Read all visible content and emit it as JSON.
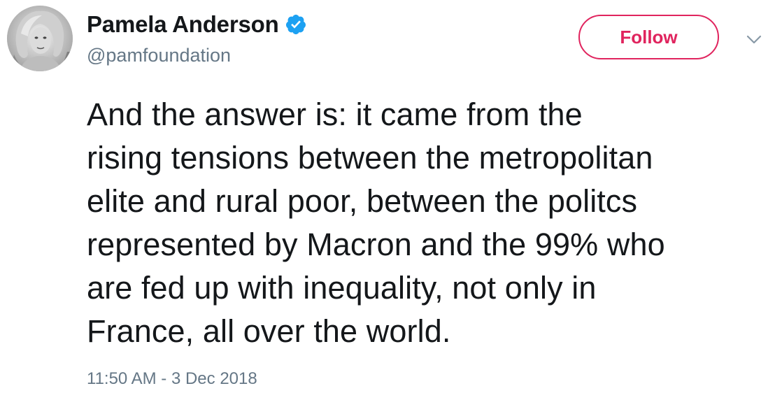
{
  "author": {
    "display_name": "Pamela Anderson",
    "handle": "@pamfoundation",
    "verified": true,
    "avatar_icon": "profile-photo"
  },
  "actions": {
    "follow_label": "Follow",
    "menu_icon": "chevron-down-icon"
  },
  "tweet": {
    "lines": [
      "And the answer is: it came from the",
      "rising tensions between the metropolitan",
      "elite and rural poor, between the politcs",
      "represented by Macron and the 99% who",
      "are fed up with inequality, not only in",
      "France, all over the world."
    ],
    "timestamp": "11:50 AM - 3 Dec 2018"
  },
  "colors": {
    "follow_accent": "#e0245e",
    "verified_blue": "#1da1f2",
    "secondary_text": "#657786",
    "primary_text": "#14171a"
  }
}
